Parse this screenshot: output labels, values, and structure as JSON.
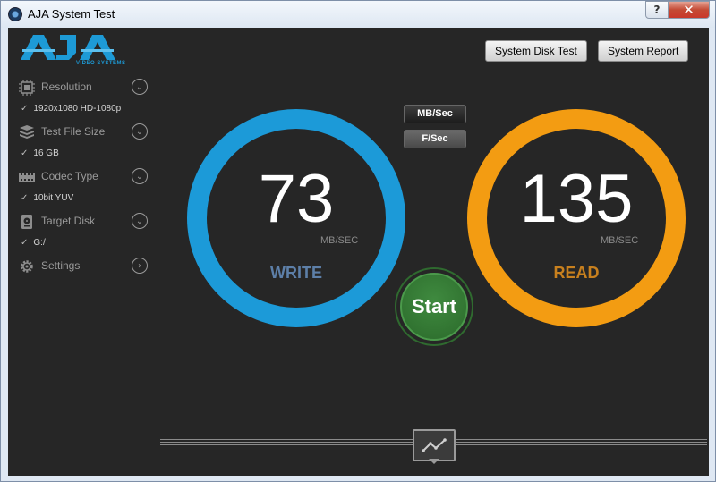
{
  "window": {
    "title": "AJA System Test",
    "help_label": "?",
    "close_label": "✕"
  },
  "logo": {
    "text": "AJA",
    "subtitle": "VIDEO SYSTEMS",
    "color": "#1d9ad6"
  },
  "sidebar": {
    "items": [
      {
        "label": "Resolution",
        "value": "1920x1080 HD-1080p",
        "icon": "resolution-icon"
      },
      {
        "label": "Test File Size",
        "value": "16 GB",
        "icon": "file-stack-icon"
      },
      {
        "label": "Codec Type",
        "value": "10bit YUV",
        "icon": "film-strip-icon"
      },
      {
        "label": "Target Disk",
        "value": "G:/",
        "icon": "disk-icon"
      },
      {
        "label": "Settings",
        "value": "",
        "icon": "gear-icon"
      }
    ]
  },
  "toolbar": {
    "system_disk_test": "System Disk Test",
    "system_report": "System Report"
  },
  "units": {
    "mb_sec": "MB/Sec",
    "f_sec": "F/Sec",
    "selected": "MB/Sec"
  },
  "write": {
    "value": "73",
    "unit": "MB/SEC",
    "label": "WRITE",
    "ring_color": "#1c9ad8",
    "label_color": "#5d7fa8"
  },
  "read": {
    "value": "135",
    "unit": "MB/SEC",
    "label": "READ",
    "ring_color": "#f39c12",
    "label_color": "#c8801e"
  },
  "start": {
    "label": "Start",
    "color": "#3a7d3a"
  }
}
